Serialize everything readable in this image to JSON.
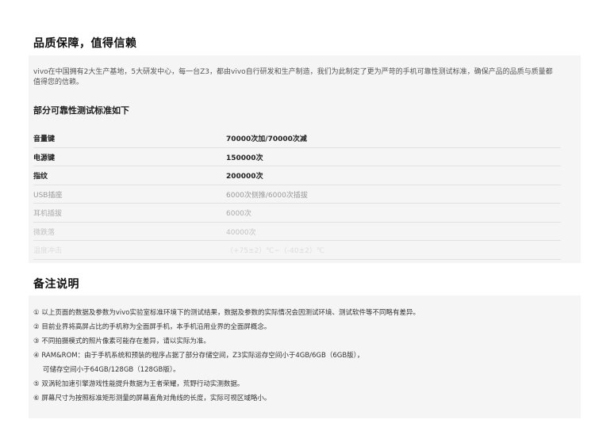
{
  "quality": {
    "title": "品质保障，值得信赖",
    "intro": "vivo在中国拥有2大生产基地，5大研发中心，每一台Z3，都由vivo自行研发和生产制造，我们为此制定了更为严苛的手机可靠性测试标准，确保产品的品质与质量都值得您的信赖。",
    "subtitle": "部分可靠性测试标准如下",
    "rows": [
      {
        "name": "音量键",
        "value": "70000次加/70000次减",
        "color": "#222222",
        "bold": true
      },
      {
        "name": "电源键",
        "value": "150000次",
        "color": "#222222",
        "bold": true
      },
      {
        "name": "指纹",
        "value": "200000次",
        "color": "#222222",
        "bold": true
      },
      {
        "name": "USB插座",
        "value": "6000次侧推/6000次插拔",
        "color": "#999999",
        "bold": false
      },
      {
        "name": "耳机插拔",
        "value": "6000次",
        "color": "#aaaaaa",
        "bold": false
      },
      {
        "name": "微跌落",
        "value": "40000次",
        "color": "#c2c2c2",
        "bold": false
      },
      {
        "name": "温度冲击",
        "value": "（+75±2）℃~（-40±2）℃",
        "color": "#dddddd",
        "bold": false
      }
    ]
  },
  "notes": {
    "title": "备注说明",
    "items": [
      "① 以上页面的数据及参数为vivo实验室标准环境下的测试结果，数据及参数的实际情况会因测试环境、测试软件等不同略有差异。",
      "② 目前业界将高屏占比的手机称为全面屏手机，本手机沿用业界的全面屏概念。",
      "③ 不同拍摄模式的照片像素可能存在差异，请以实际为准。",
      "④ RAM&ROM：由于手机系统和预装的程序占据了部分存储空间，Z3实际运存空间小于4GB/6GB（6GB版），",
      "可储存空间小于64GB/128GB（128GB版）。",
      "⑤ 双涡轮加速引擎游戏性能提升数据为王者荣耀，荒野行动实测数据。",
      "⑥ 屏幕尺寸为按照标准矩形测量的屏幕直角对角线的长度，实际可视区域略小。"
    ]
  }
}
